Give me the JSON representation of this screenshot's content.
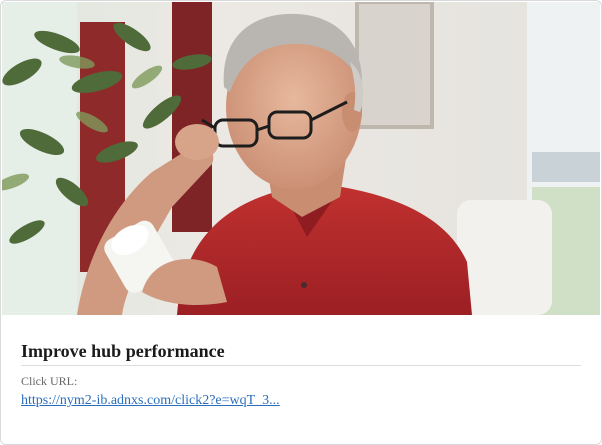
{
  "card": {
    "image_alt": "Senior man with glasses reading a pill bottle",
    "title": "Improve hub performance",
    "click_url_label": "Click URL:",
    "click_url": "https://nym2-ib.adnxs.com/click2?e=wqT_3..."
  },
  "colors": {
    "title": "#1a1a1a",
    "label": "#666666",
    "link": "#2a6ebb",
    "border": "#d9d9d9",
    "shirt": "#b3262b"
  }
}
